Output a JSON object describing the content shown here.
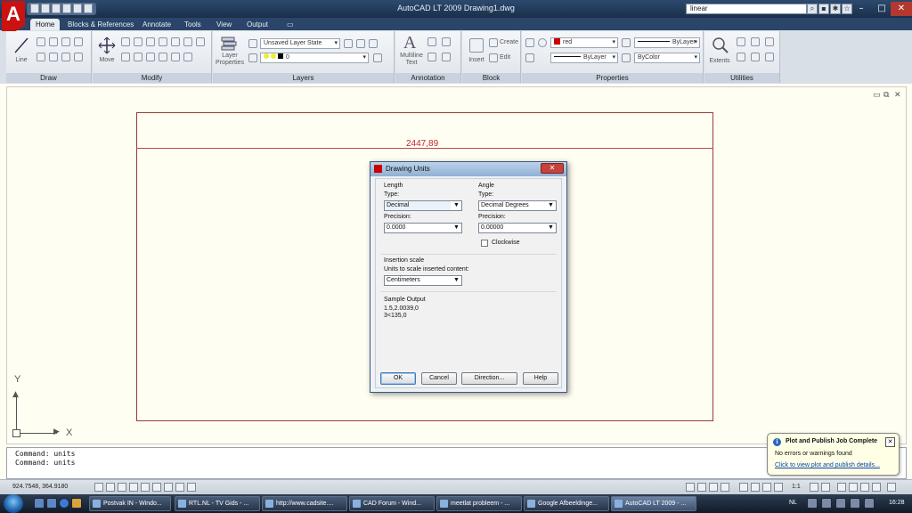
{
  "window": {
    "title": "AutoCAD LT 2009  Drawing1.dwg",
    "search_value": "linear",
    "minimize": "–",
    "maximize": "□",
    "close": "✕"
  },
  "ribbon": {
    "tabs": [
      "Home",
      "Blocks & References",
      "Annotate",
      "Tools",
      "View",
      "Output"
    ],
    "panels": {
      "draw": "Draw",
      "modify": "Modify",
      "layers": "Layers",
      "annotation": "Annotation",
      "block": "Block",
      "properties": "Properties",
      "utilities": "Utilities"
    },
    "tools": {
      "line": "Line",
      "move": "Move",
      "layer_properties": "Layer Properties",
      "multiline_text": "Multiline Text",
      "insert": "Insert",
      "create": "Create",
      "edit": "Edit",
      "extents": "Extents"
    },
    "layer_state": "Unsaved Layer State",
    "current_layer": "0",
    "color": "red",
    "linetype": "ByLayer",
    "lineweight": "ByLayer",
    "plot_style": "ByColor"
  },
  "drawing": {
    "dimension_text": "2447,89",
    "ucs_x": "X",
    "ucs_y": "Y"
  },
  "dialog": {
    "title": "Drawing Units",
    "length": {
      "group": "Length",
      "type_label": "Type:",
      "type_value": "Decimal",
      "precision_label": "Precision:",
      "precision_value": "0.0000"
    },
    "angle": {
      "group": "Angle",
      "type_label": "Type:",
      "type_value": "Decimal Degrees",
      "precision_label": "Precision:",
      "precision_value": "0.00000",
      "clockwise_label": "Clockwise"
    },
    "insertion": {
      "group": "Insertion scale",
      "label": "Units to scale inserted content:",
      "value": "Centimeters"
    },
    "sample": {
      "group": "Sample Output",
      "line1": "1.5,2.0039,0",
      "line2": "3<135,0"
    },
    "buttons": {
      "ok": "OK",
      "cancel": "Cancel",
      "direction": "Direction...",
      "help": "Help"
    }
  },
  "command_line": {
    "lines": [
      "Command: units",
      "Command: units"
    ]
  },
  "status_bar": {
    "coordinates": "924.7548, 364.9180",
    "scale": "1:1"
  },
  "notification": {
    "title": "Plot and Publish Job Complete",
    "message": "No errors or warnings found",
    "link": "Click to view plot and publish details..."
  },
  "taskbar": {
    "items": [
      "Postvak IN - Windo...",
      "RTL.NL - TV Gids - ...",
      "http://www.cadsite....",
      "CAD Forum - Wind...",
      "meetlat probleem - ...",
      "Google Afbeeldinge...",
      "AutoCAD LT 2009 - ..."
    ],
    "language": "NL",
    "clock": "16:28"
  },
  "colors": {
    "accent_red": "#c0262b",
    "title_bar": "#2c4a6e",
    "canvas": "#fffef2"
  }
}
